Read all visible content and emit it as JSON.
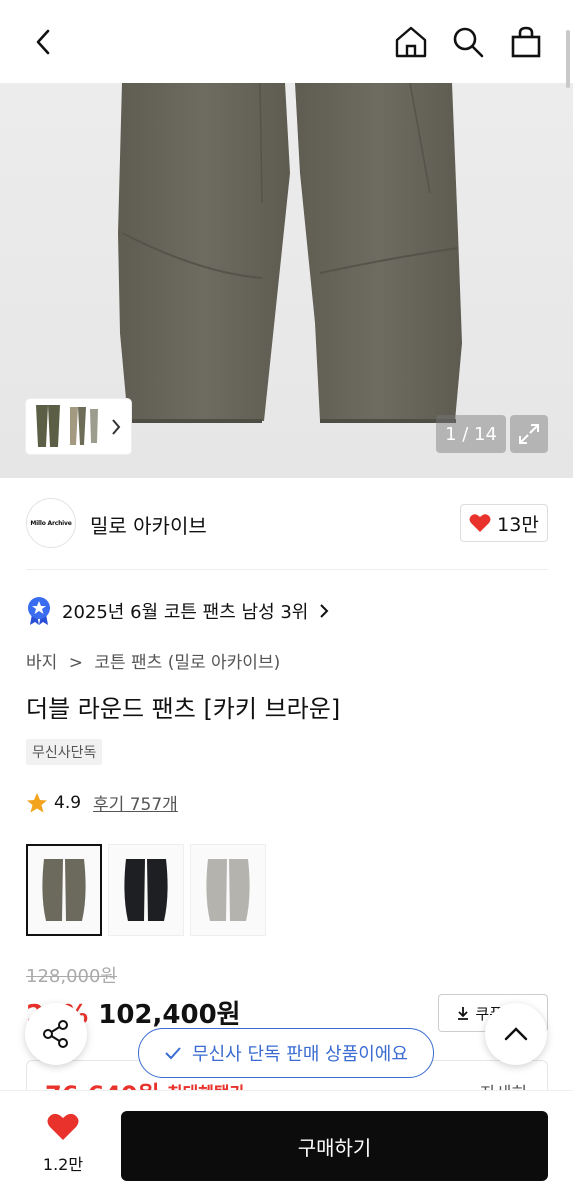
{
  "header": {
    "back_icon": "chevron-left-icon",
    "home_icon": "home-icon",
    "search_icon": "search-icon",
    "cart_icon": "shopping-bag-icon"
  },
  "gallery": {
    "counter": "1 / 14",
    "product_color": "#6c6a60"
  },
  "brand": {
    "logo_text": "Millo Archive",
    "name": "밀로 아카이브",
    "likes": "13만",
    "like_color": "#e8322b"
  },
  "ranking": {
    "text": "2025년 6월 코튼 팬츠 남성 3위"
  },
  "breadcrumb": {
    "category": "바지",
    "subcategory": "코튼 팬츠 (밀로 아카이브)"
  },
  "product": {
    "title": "더블 라운드 팬츠 [카키 브라운]",
    "tag": "무신사단독",
    "rating": "4.9",
    "review_text": "후기 757개"
  },
  "swatches": [
    {
      "name": "카키 브라운",
      "color": "#6c6a5c"
    },
    {
      "name": "블랙",
      "color": "#1e1f23"
    },
    {
      "name": "그레이",
      "color": "#b5b3ae"
    }
  ],
  "pricing": {
    "original": "128,000원",
    "discount": "20%",
    "price": "102,400원",
    "coupon_label": "쿠폰받기",
    "max_benefit_price": "76,640원",
    "max_benefit_label": "최대혜택가",
    "detail_label": "자세히"
  },
  "toast": {
    "text": "무신사 단독 판매 상품이에요"
  },
  "bottom": {
    "wish_count": "1.2만",
    "buy_label": "구매하기"
  }
}
